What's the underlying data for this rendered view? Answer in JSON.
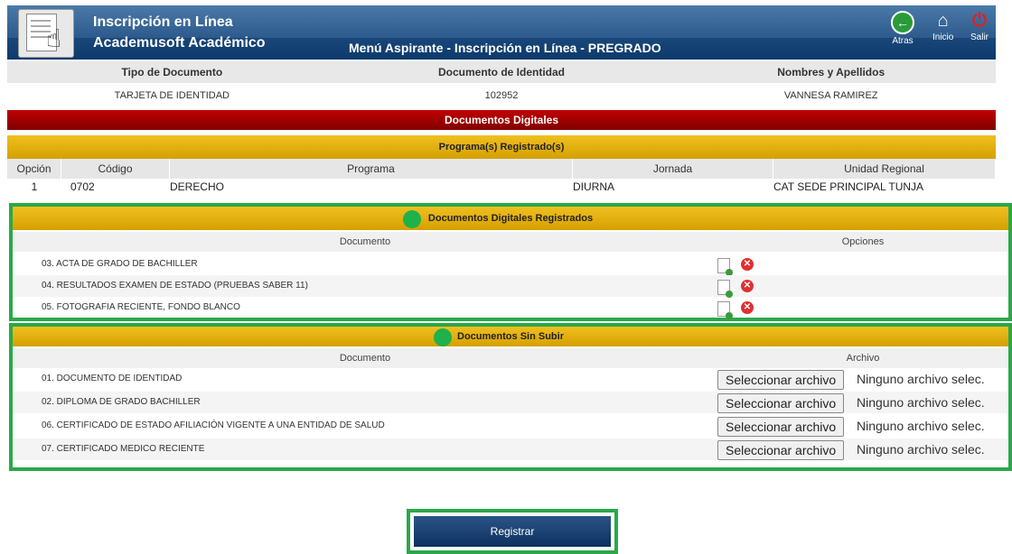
{
  "header": {
    "title_line1": "Inscripción en Línea",
    "title_line2": "Academusoft Académico",
    "menu_title": "Menú Aspirante - Inscripción en Línea - PREGRADO",
    "nav": {
      "back": "Atras",
      "home": "Inicio",
      "exit": "Salir"
    }
  },
  "identity": {
    "headers": [
      "Tipo de Documento",
      "Documento de Identidad",
      "Nombres y Apellidos"
    ],
    "values": [
      "TARJETA DE IDENTIDAD",
      "102952",
      "VANNESA RAMIREZ"
    ]
  },
  "digital_docs_title": "Documentos Digitales",
  "programs": {
    "title": "Programa(s) Registrado(s)",
    "headers": [
      "Opción",
      "Código",
      "Programa",
      "Jornada",
      "Unidad Regional"
    ],
    "rows": [
      [
        "1",
        "0702",
        "DERECHO",
        "DIURNA",
        "CAT SEDE PRINCIPAL TUNJA"
      ]
    ]
  },
  "registered": {
    "title": "Documentos Digitales Registrados",
    "col_doc": "Documento",
    "col_opts": "Opciones",
    "items": [
      "03. ACTA DE GRADO DE BACHILLER",
      "04. RESULTADOS EXAMEN DE ESTADO (PRUEBAS SABER 11)",
      "05. FOTOGRAFIA RECIENTE, FONDO BLANCO"
    ]
  },
  "pending": {
    "title": "Documentos Sin Subir",
    "col_doc": "Documento",
    "col_file": "Archivo",
    "button_label": "Seleccionar archivo",
    "no_file_text": "Ninguno archivo selec.",
    "items": [
      "01. DOCUMENTO DE IDENTIDAD",
      "02. DIPLOMA DE GRADO BACHILLER",
      "06. CERTIFICADO DE ESTADO AFILIACIÓN VIGENTE A UNA ENTIDAD DE SALUD",
      "07. CERTIFICADO MEDICO RECIENTE"
    ]
  },
  "submit_label": "Registrar"
}
